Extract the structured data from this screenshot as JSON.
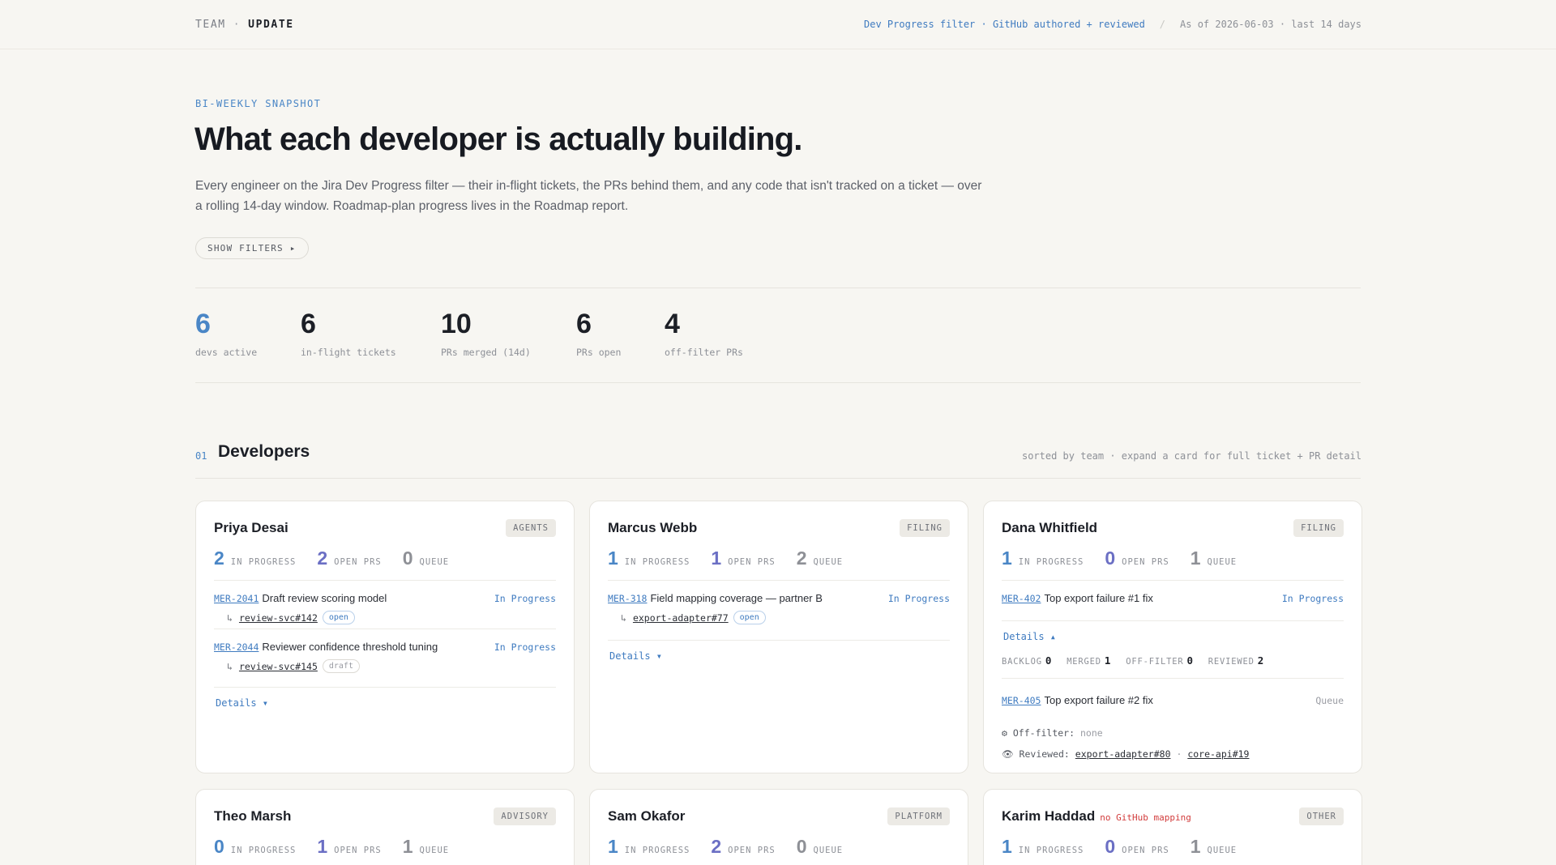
{
  "header": {
    "brand_left": "TEAM",
    "brand_sep": "·",
    "brand_right": "UPDATE",
    "filter_info": "Dev Progress filter · GitHub authored + reviewed",
    "separator": "/",
    "as_of": "As of 2026-06-03 · last 14 days"
  },
  "hero": {
    "kicker": "BI-WEEKLY SNAPSHOT",
    "title": "What each developer is actually building.",
    "lede": "Every engineer on the Jira Dev Progress filter — their in-flight tickets, the PRs behind them, and any code that isn't tracked on a ticket — over a rolling 14-day window. Roadmap-plan progress lives in the Roadmap report.",
    "filters_button": "SHOW FILTERS ▸"
  },
  "stats": [
    {
      "value": "6",
      "label": "devs active"
    },
    {
      "value": "6",
      "label": "in-flight tickets"
    },
    {
      "value": "10",
      "label": "PRs merged (14d)"
    },
    {
      "value": "6",
      "label": "PRs open"
    },
    {
      "value": "4",
      "label": "off-filter PRs"
    }
  ],
  "section": {
    "number": "01",
    "title": "Developers",
    "note": "sorted by team · expand a card for full ticket + PR detail"
  },
  "labels": {
    "in_progress": "IN PROGRESS",
    "open_prs": "OPEN PRS",
    "queue": "QUEUE",
    "details_closed": "Details ▾",
    "details_open": "Details ▴",
    "arrow": "↳",
    "backlog": "BACKLOG",
    "merged": "MERGED",
    "off_filter": "OFF-FILTER",
    "reviewed": "REVIEWED",
    "off_filter_line": "Off-filter:",
    "reviewed_line": "Reviewed:",
    "none": "none",
    "dot": "·"
  },
  "devs": [
    {
      "name": "Priya Desai",
      "team": "AGENTS",
      "in_progress": "2",
      "open_prs": "2",
      "queue": "0",
      "tickets": [
        {
          "key": "MER-2041",
          "summary": "Draft review scoring model",
          "status": "In Progress",
          "pr": "review-svc#142",
          "pr_state": "open"
        },
        {
          "key": "MER-2044",
          "summary": "Reviewer confidence threshold tuning",
          "status": "In Progress",
          "pr": "review-svc#145",
          "pr_state": "draft"
        }
      ]
    },
    {
      "name": "Marcus Webb",
      "team": "FILING",
      "in_progress": "1",
      "open_prs": "1",
      "queue": "2",
      "tickets": [
        {
          "key": "MER-318",
          "summary": "Field mapping coverage — partner B",
          "status": "In Progress",
          "pr": "export-adapter#77",
          "pr_state": "open"
        }
      ]
    },
    {
      "name": "Dana Whitfield",
      "team": "FILING",
      "in_progress": "1",
      "open_prs": "0",
      "queue": "1",
      "tickets": [
        {
          "key": "MER-402",
          "summary": "Top export failure #1 fix",
          "status": "In Progress"
        },
        {
          "key": "MER-405",
          "summary": "Top export failure #2 fix",
          "status": "Queue"
        }
      ],
      "metrics": {
        "backlog": "0",
        "merged": "1",
        "off_filter": "0",
        "reviewed": "2"
      },
      "reviewed_prs": [
        "export-adapter#80",
        "core-api#19"
      ]
    },
    {
      "name": "Theo Marsh",
      "team": "ADVISORY",
      "in_progress": "0",
      "open_prs": "1",
      "queue": "1"
    },
    {
      "name": "Sam Okafor",
      "team": "PLATFORM",
      "in_progress": "1",
      "open_prs": "2",
      "queue": "0"
    },
    {
      "name": "Karim Haddad",
      "team": "OTHER",
      "warning": "no GitHub mapping",
      "in_progress": "1",
      "open_prs": "0",
      "queue": "1"
    }
  ],
  "colors": {
    "accent": "#4a86c6",
    "open_prs": "#6b6fc4",
    "warning": "#d23c3c",
    "background": "#f7f6f2"
  }
}
